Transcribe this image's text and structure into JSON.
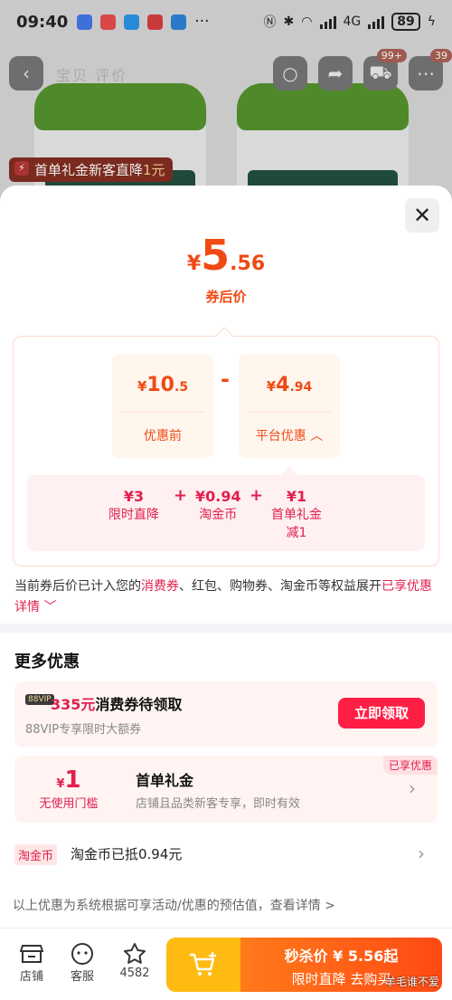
{
  "status_bar": {
    "time": "09:40",
    "network": "4G",
    "battery": "89"
  },
  "background_page": {
    "nav_title": "宝贝  评价",
    "cart_badge": "99+",
    "message_badge": "39",
    "new_user_tag": {
      "text": "首单礼金新客直降",
      "amount": "1元"
    }
  },
  "sheet": {
    "final_price": {
      "currency": "¥",
      "integer": "5",
      "decimal": ".56",
      "label": "券后价"
    },
    "calc": {
      "original": {
        "currency": "¥",
        "value": "10",
        "decimal": ".5",
        "label": "优惠前"
      },
      "operator": "-",
      "discount": {
        "currency": "¥",
        "value": "4",
        "decimal": ".94",
        "label": "平台优惠"
      },
      "breakdown": [
        {
          "value": "¥3",
          "label": "限时直降"
        },
        {
          "value": "¥0.94",
          "label": "淘金币"
        },
        {
          "value": "¥1",
          "label": "首单礼金",
          "label2": "减1"
        }
      ],
      "plus": "+"
    },
    "note": {
      "prefix": "当前券后价已计入您的",
      "hl": "消费券",
      "suffix": "、红包、购物券、淘金币等权益展开",
      "more": "已享优惠详情"
    },
    "more_offers": {
      "title": "更多优惠",
      "coupon": {
        "vip_badge": "88VIP",
        "amount": "335元",
        "amount_suffix": "消费券待领取",
        "subtitle": "88VIP专享限时大额券",
        "claim_button": "立即领取"
      },
      "gift": {
        "currency": "¥",
        "value": "1",
        "condition": "无使用门槛",
        "title": "首单礼金",
        "desc": "店铺且品类新客专享，即时有效",
        "enjoyed": "已享优惠"
      },
      "coins": {
        "tag": "淘金币",
        "text": "淘金币已抵0.94元"
      }
    },
    "disclaimer": "以上优惠为系统根据可享活动/优惠的预估值，查看详情 >"
  },
  "bottom_bar": {
    "shop": "店铺",
    "service": "客服",
    "favorites": "4582",
    "buy": {
      "line1": "秒杀价 ¥ 5.56起",
      "line2": "限时直降  去购买"
    }
  },
  "watermark": "羊毛谁不爱",
  "colors": {
    "accent_orange": "#f04a14",
    "accent_red": "#e0204d",
    "claim_button": "#ff1f45",
    "cart_yellow": "#ffbb12"
  }
}
